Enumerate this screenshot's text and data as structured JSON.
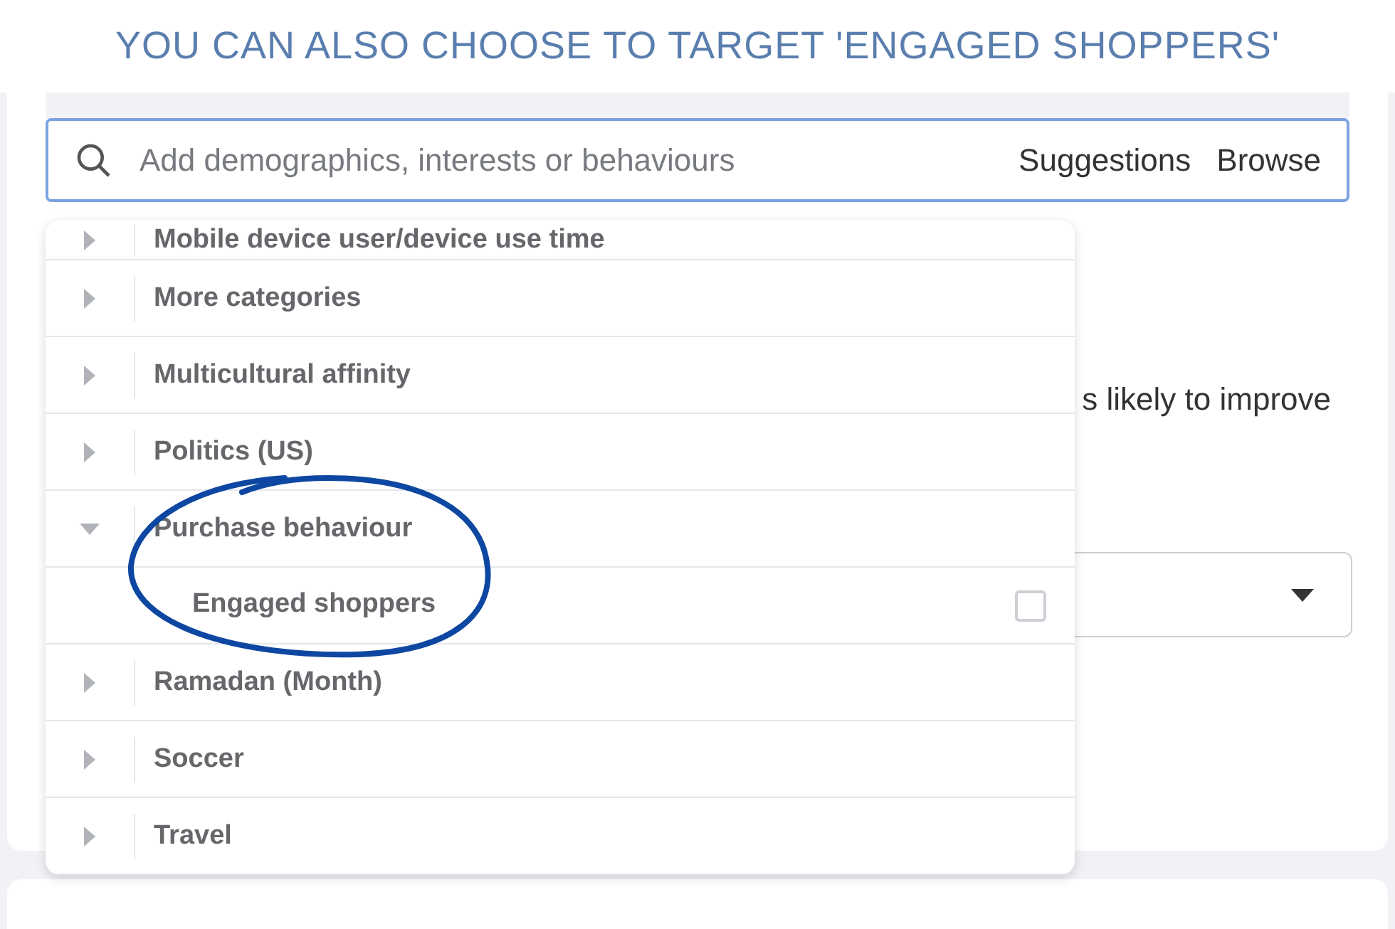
{
  "annotation": {
    "title": "YOU CAN ALSO CHOOSE TO TARGET 'ENGAGED SHOPPERS'"
  },
  "search": {
    "placeholder": "Add demographics, interests or behaviours",
    "links": [
      "Suggestions",
      "Browse"
    ]
  },
  "background_text": "s likely to improve",
  "dropdown": {
    "items": [
      {
        "label": "Mobile device user/device use time",
        "expanded": false
      },
      {
        "label": "More categories",
        "expanded": false
      },
      {
        "label": "Multicultural affinity",
        "expanded": false
      },
      {
        "label": "Politics (US)",
        "expanded": false
      },
      {
        "label": "Purchase behaviour",
        "expanded": true,
        "children": [
          {
            "label": "Engaged shoppers",
            "checked": false
          }
        ]
      },
      {
        "label": "Ramadan (Month)",
        "expanded": false
      },
      {
        "label": "Soccer",
        "expanded": false
      },
      {
        "label": "Travel",
        "expanded": false
      }
    ]
  }
}
